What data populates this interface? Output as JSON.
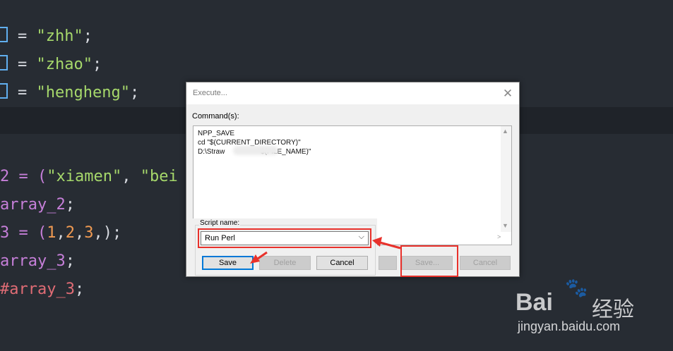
{
  "editor": {
    "lines": [
      {
        "pre": "= ",
        "str": "\"zhh\"",
        "post": ";"
      },
      {
        "pre": "= ",
        "str": "\"zhao\"",
        "post": ";"
      },
      {
        "pre": "= ",
        "str": "\"hengheng\"",
        "post": ";"
      }
    ],
    "line5": {
      "a": "2 = (",
      "s1": "\"xiamen\"",
      "b": ", ",
      "s2": "\"bei"
    },
    "line6": {
      "a": "array_2",
      "b": ";"
    },
    "line7": {
      "a": "3 = (",
      "n1": "1",
      "c1": ",",
      "n2": "2",
      "c2": ",",
      "n3": "3",
      "c3": ",);"
    },
    "line8": {
      "a": "array_3",
      "b": ";"
    },
    "line9": {
      "a": "#array_3",
      "b": ";"
    }
  },
  "dialog": {
    "title": "Execute...",
    "commands_label": "Command(s):",
    "command_lines": [
      "NPP_SAVE",
      "cd \"$(CURRENT_DIRECTORY)\"",
      "D:\\Straw                 \"$(FILE_NAME)\""
    ],
    "script_name_label": "Script name:",
    "script_name_value": "Run Perl",
    "buttons": {
      "save": "Save",
      "delete": "Delete",
      "cancel": "Cancel",
      "save2": "Save...",
      "cancel2": "Cancel"
    }
  },
  "watermark": {
    "brand": "Bai",
    "brand2": "经验",
    "url": "jingyan.baidu.com"
  },
  "colors": {
    "annotation": "#e8312b",
    "editor_bg": "#272c33",
    "string": "#a6d86b"
  }
}
